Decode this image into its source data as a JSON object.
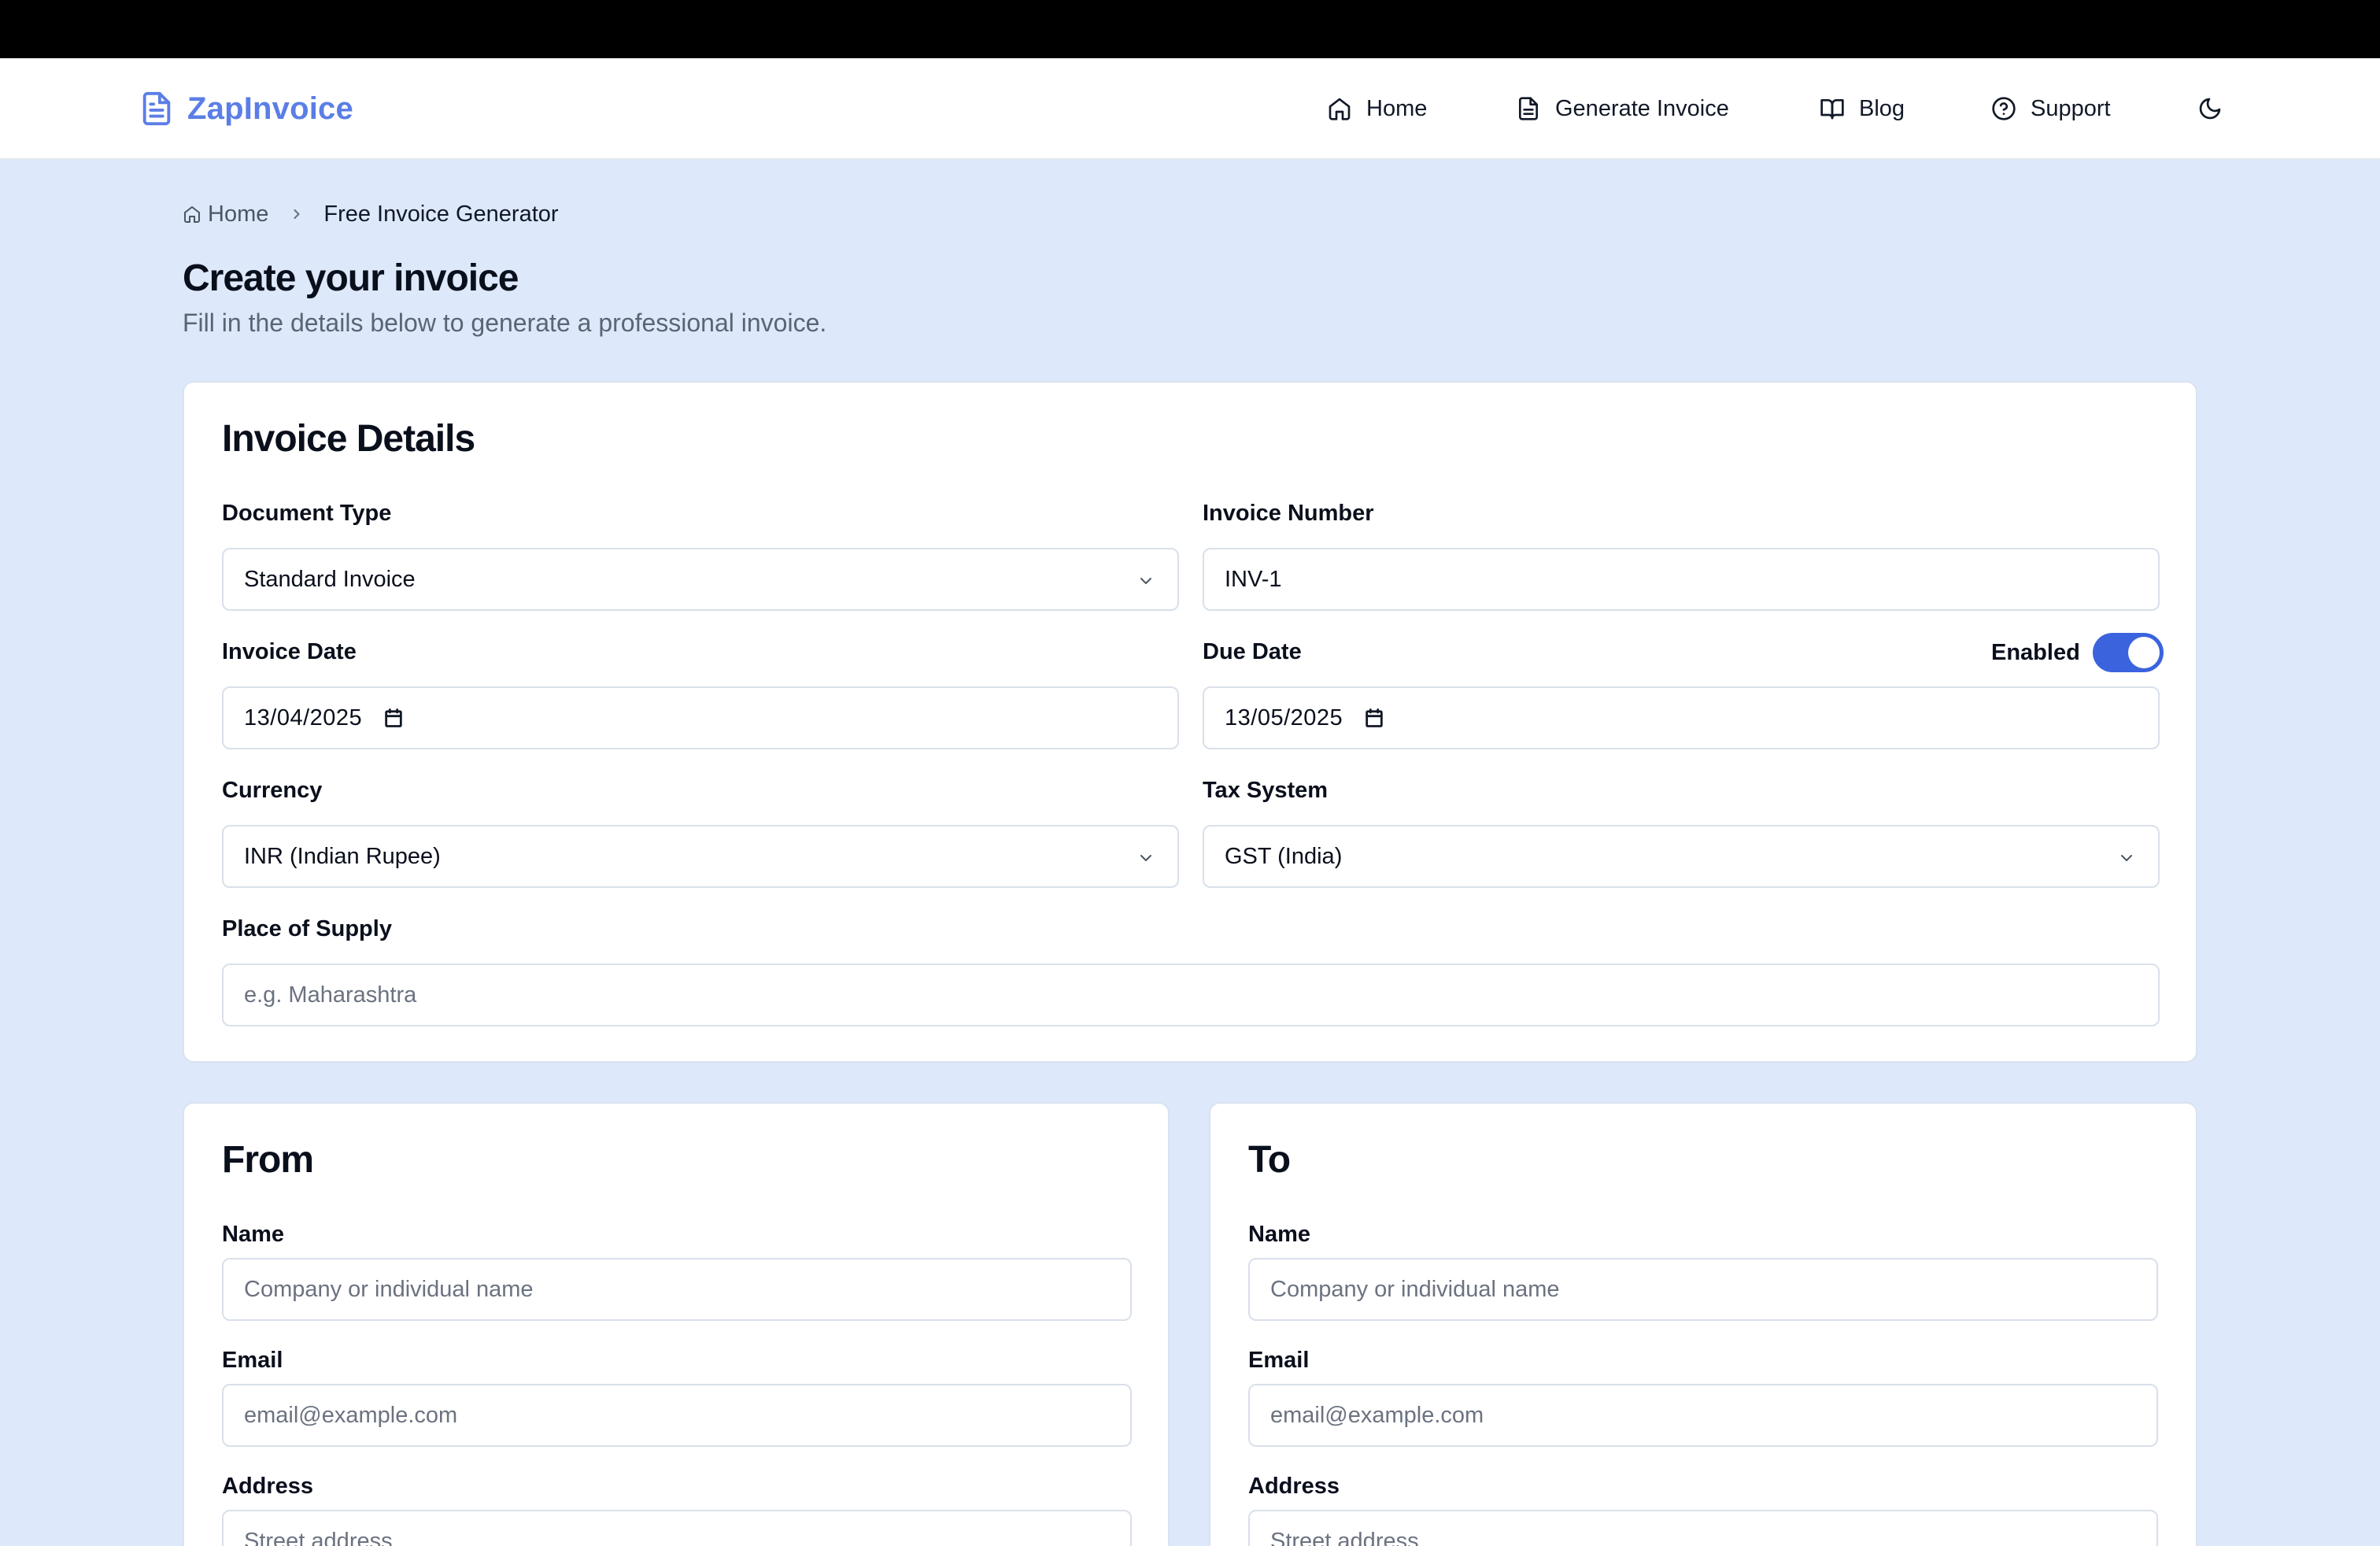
{
  "brand": {
    "name": "ZapInvoice",
    "color": "#5b7ee6"
  },
  "nav": {
    "home": "Home",
    "generate": "Generate Invoice",
    "blog": "Blog",
    "support": "Support"
  },
  "breadcrumb": {
    "home": "Home",
    "current": "Free Invoice Generator"
  },
  "page": {
    "title": "Create your invoice",
    "subtitle": "Fill in the details below to generate a professional invoice."
  },
  "details": {
    "title": "Invoice Details",
    "document_type": {
      "label": "Document Type",
      "value": "Standard Invoice"
    },
    "invoice_number": {
      "label": "Invoice Number",
      "value": "INV-1"
    },
    "invoice_date": {
      "label": "Invoice Date",
      "value": "13/04/2025"
    },
    "due_date": {
      "label": "Due Date",
      "value": "13/05/2025",
      "toggle_label": "Enabled",
      "enabled": true
    },
    "currency": {
      "label": "Currency",
      "value": "INR (Indian Rupee)"
    },
    "tax_system": {
      "label": "Tax System",
      "value": "GST (India)"
    },
    "place_of_supply": {
      "label": "Place of Supply",
      "placeholder": "e.g. Maharashtra"
    }
  },
  "from": {
    "title": "From",
    "name_label": "Name",
    "name_placeholder": "Company or individual name",
    "email_label": "Email",
    "email_placeholder": "email@example.com",
    "address_label": "Address",
    "address_placeholder": "Street address"
  },
  "to": {
    "title": "To",
    "name_label": "Name",
    "name_placeholder": "Company or individual name",
    "email_label": "Email",
    "email_placeholder": "email@example.com",
    "address_label": "Address",
    "address_placeholder": "Street address"
  },
  "colors": {
    "page_bg": "#dde8fa",
    "accent": "#3b63dd",
    "card_bg": "#ffffff",
    "topbar": "#000000"
  },
  "icons": [
    "file-text-icon",
    "home-icon",
    "book-open-icon",
    "help-circle-icon",
    "moon-icon",
    "chevron-right-icon",
    "chevron-down-icon",
    "calendar-icon"
  ]
}
